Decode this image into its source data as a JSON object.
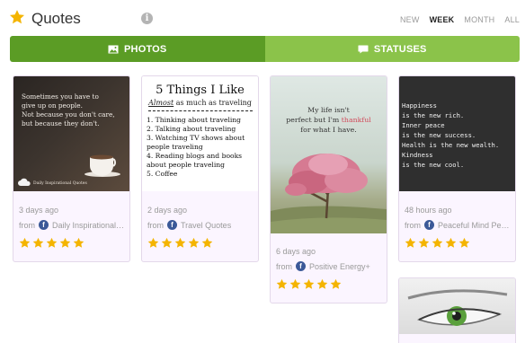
{
  "header": {
    "title": "Quotes",
    "info_glyph": "i",
    "periods": [
      "NEW",
      "WEEK",
      "MONTH",
      "ALL"
    ],
    "active_period": "WEEK"
  },
  "tabs": {
    "photos_label": "PHOTOS",
    "statuses_label": "STATUSES"
  },
  "colors": {
    "tab_active": "#5b9c25",
    "tab_inactive": "#8bc34a",
    "star": "#f4b400",
    "facebook": "#3b5998",
    "card_bg": "#fbf5ff"
  },
  "icons": {
    "header": "star-icon",
    "info": "info-icon",
    "photos_tab": "image-icon",
    "statuses_tab": "speech-bubble-icon",
    "source": "facebook-icon",
    "rating": "star-icon"
  },
  "cards": [
    {
      "time": "3 days ago",
      "from_label": "from",
      "source": "Daily Inspirational ...",
      "rating": 5,
      "image_text": [
        "Sometimes you have to",
        "give up on people.",
        "Not because you don't care,",
        "but because they don't."
      ],
      "image_brand": "Daily Inspirational Quotes"
    },
    {
      "time": "2 days ago",
      "from_label": "from",
      "source": "Travel Quotes",
      "rating": 5,
      "image_heading": "5 Things I Like",
      "image_subheading_em": "Almost",
      "image_subheading_rest": "as much as traveling",
      "image_list": [
        "1. Thinking about traveling",
        "2. Talking about traveling",
        "3. Watching TV shows about people traveling",
        "4. Reading blogs and books about people traveling",
        "5. Coffee"
      ]
    },
    {
      "time": "6 days ago",
      "from_label": "from",
      "source": "Positive Energy+",
      "rating": 5,
      "image_line1": "My life isn't",
      "image_line2_a": "perfect but I'm",
      "image_line2_b": "thankful",
      "image_line3": "for what I have."
    },
    {
      "time": "48 hours ago",
      "from_label": "from",
      "source": "Peaceful Mind Pea...",
      "rating": 5,
      "image_text": "Happiness\nis the new rich.\nInner peace\nis the new success.\nHealth is the new wealth.\nKindness\nis the new cool."
    }
  ]
}
